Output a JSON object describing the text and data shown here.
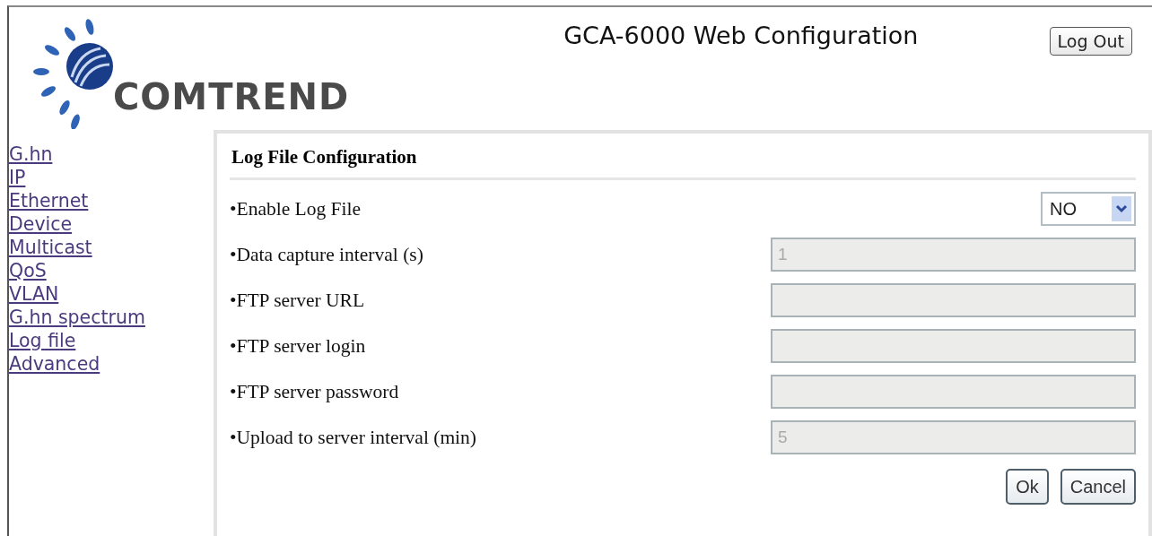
{
  "header": {
    "logo_text": "COMTREND",
    "title": "GCA-6000 Web Configuration",
    "logout_button": "Log Out"
  },
  "sidebar": {
    "items": [
      {
        "label": "G.hn"
      },
      {
        "label": "IP"
      },
      {
        "label": "Ethernet"
      },
      {
        "label": "Device"
      },
      {
        "label": "Multicast"
      },
      {
        "label": "QoS"
      },
      {
        "label": "VLAN"
      },
      {
        "label": "G.hn spectrum"
      },
      {
        "label": "Log file"
      },
      {
        "label": "Advanced"
      }
    ]
  },
  "panel": {
    "title": "Log File Configuration",
    "rows": [
      {
        "kind": "select",
        "label": "•Enable Log File",
        "value": "NO",
        "disabled": false
      },
      {
        "kind": "text",
        "label": "•Data capture interval (s)",
        "value": "1",
        "disabled": true
      },
      {
        "kind": "text",
        "label": "•FTP server URL",
        "disabled": true
      },
      {
        "kind": "text",
        "label": "•FTP server login",
        "disabled": true
      },
      {
        "kind": "text",
        "label": "•FTP server password",
        "disabled": true
      },
      {
        "kind": "text",
        "label": "•Upload to server interval (min)",
        "value": "5",
        "disabled": true
      }
    ],
    "buttons": [
      "Ok",
      "Cancel"
    ]
  }
}
